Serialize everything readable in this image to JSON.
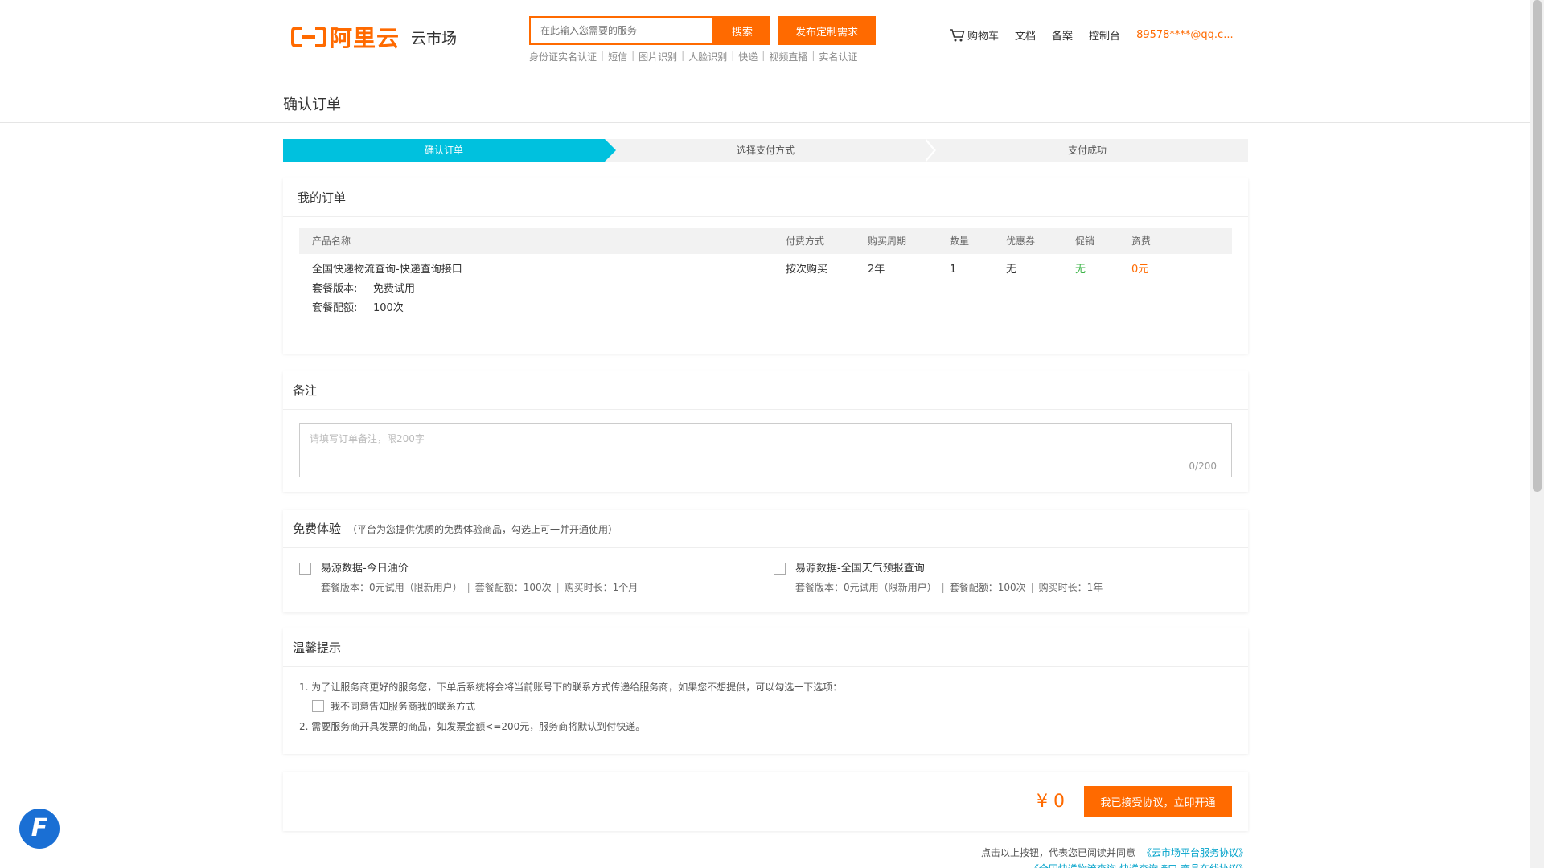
{
  "header": {
    "logo_text": "阿里云",
    "logo_sub": "云市场",
    "search_placeholder": "在此输入您需要的服务",
    "search_label": "搜索",
    "publish_label": "发布定制需求",
    "hot_links": [
      "身份证实名认证",
      "短信",
      "图片识别",
      "人脸识别",
      "快递",
      "视频直播",
      "实名认证"
    ],
    "nav": {
      "cart": "购物车",
      "docs": "文档",
      "beian": "备案",
      "console": "控制台",
      "user": "89578****@qq.c..."
    }
  },
  "page_title": "确认订单",
  "steps": [
    "确认订单",
    "选择支付方式",
    "支付成功"
  ],
  "order": {
    "title": "我的订单",
    "columns": [
      "产品名称",
      "付费方式",
      "购买周期",
      "数量",
      "优惠券",
      "促销",
      "资费"
    ],
    "row": {
      "product": "全国快递物流查询-快递查询接口",
      "plan_label": "套餐版本:",
      "plan_value": "免费试用",
      "quota_label": "套餐配额:",
      "quota_value": "100次",
      "pay_mode": "按次购买",
      "period": "2年",
      "qty": "1",
      "coupon": "无",
      "promo": "无",
      "price": "0元"
    }
  },
  "remark": {
    "title": "备注",
    "placeholder": "请填写订单备注，限200字",
    "counter": "0/200"
  },
  "trial": {
    "title": "免费体验",
    "note": "（平台为您提供优质的免费体验商品，勾选上可一并开通使用）",
    "items": [
      {
        "name": "易源数据-今日油价",
        "version": "套餐版本：0元试用（限新用户）",
        "quota": "套餐配额：100次",
        "duration": "购买时长：1个月"
      },
      {
        "name": "易源数据-全国天气预报查询",
        "version": "套餐版本：0元试用（限新用户）",
        "quota": "套餐配额：100次",
        "duration": "购买时长：1年"
      }
    ]
  },
  "tips": {
    "title": "温馨提示",
    "line1": "1. 为了让服务商更好的服务您，下单后系统将会将当前账号下的联系方式传递给服务商，如果您不想提供，可以勾选一下选项：",
    "opt1": "我不同意告知服务商我的联系方式",
    "line2": "2. 需要服务商开具发票的商品，如发票金额<=200元，服务商将默认到付快递。"
  },
  "pay": {
    "price": "¥ 0",
    "button": "我已接受协议，立即开通",
    "agree_text": "点击以上按钮，代表您已阅读并同意",
    "agree_link": "《云市场平台服务协议》",
    "agree_link2": "《全国快递物流查询-快递查询接口 商品在线协议》"
  },
  "fab_glyph": "F",
  "colors": {
    "accent": "#ff6a00",
    "step_active": "#00c1de",
    "green": "#3bb346",
    "link": "#00a2ca"
  }
}
